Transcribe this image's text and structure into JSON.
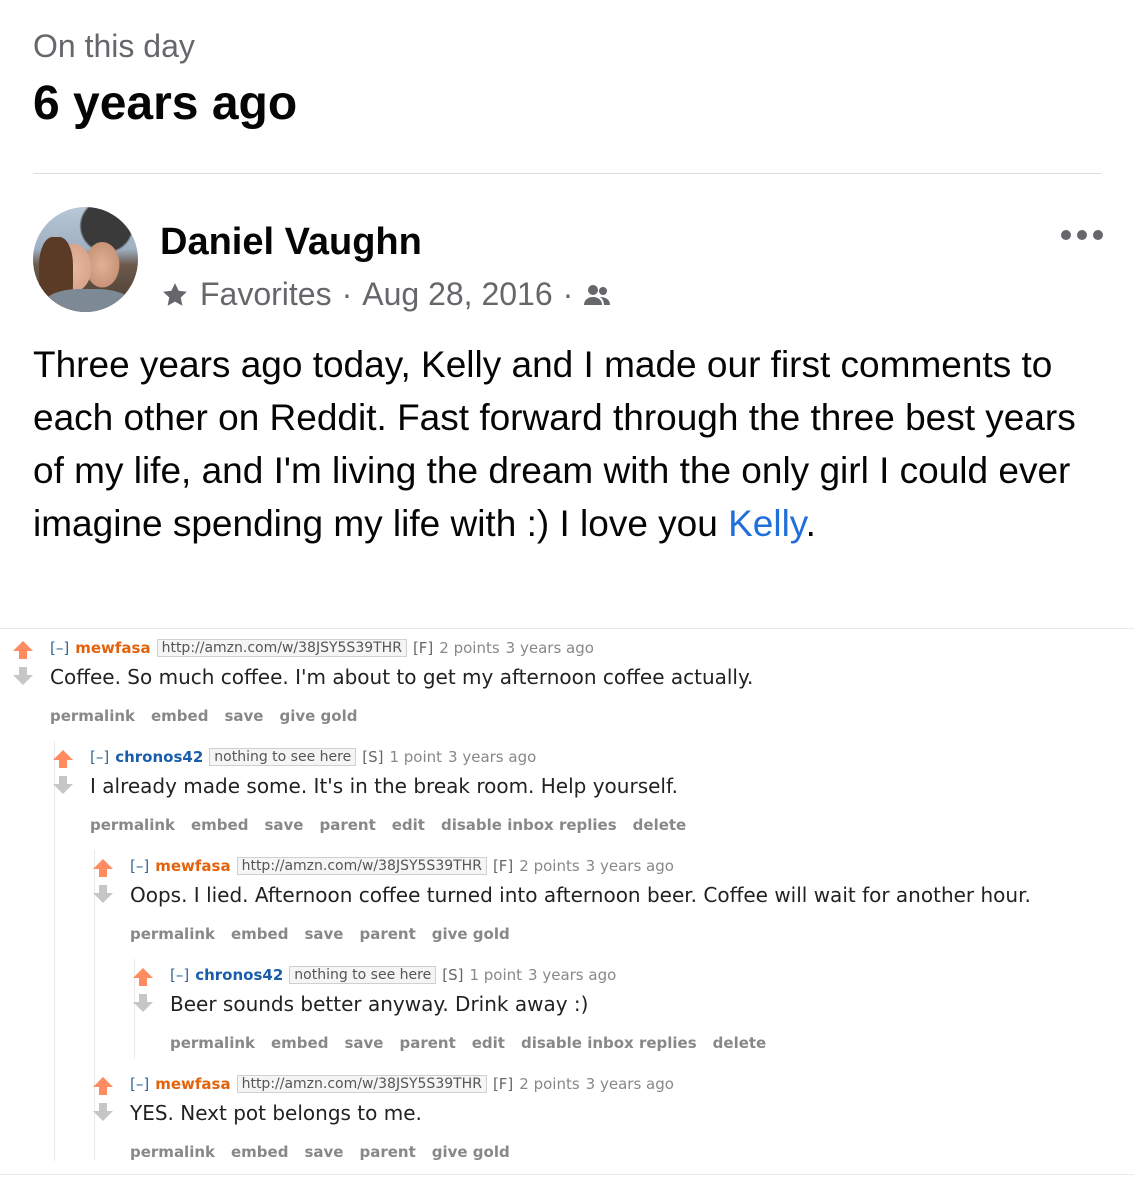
{
  "memory": {
    "label": "On this day",
    "title": "6 years ago"
  },
  "post": {
    "author": "Daniel Vaughn",
    "audience": "Favorites",
    "separator": "·",
    "date": "Aug 28, 2016",
    "text_before_mention": "Three years ago today, Kelly and I made our first comments to each other on Reddit. Fast forward through the three best years of my life, and I'm living the dream with the only girl I could ever imagine spending my life with :) I love you ",
    "mention": "Kelly",
    "text_after_mention": ".",
    "icons": {
      "audience": "star-icon",
      "privacy": "friends-icon",
      "menu": "more-options-icon",
      "avatar": "avatar-photo"
    }
  },
  "comments": [
    {
      "toggle": "[–]",
      "user": "mewfasa",
      "flair": "http://amzn.com/w/38JSY5S39THR",
      "tag": "[F]",
      "score": "2 points",
      "age": "3 years ago",
      "body": "Coffee. So much coffee. I'm about to get my afternoon coffee actually.",
      "actions": [
        "permalink",
        "embed",
        "save",
        "give gold"
      ]
    },
    {
      "toggle": "[–]",
      "user": "chronos42",
      "flair": "nothing to see here",
      "tag": "[S]",
      "score": "1 point",
      "age": "3 years ago",
      "body": "I already made some. It's in the break room. Help yourself.",
      "actions": [
        "permalink",
        "embed",
        "save",
        "parent",
        "edit",
        "disable inbox replies",
        "delete"
      ]
    },
    {
      "toggle": "[–]",
      "user": "mewfasa",
      "flair": "http://amzn.com/w/38JSY5S39THR",
      "tag": "[F]",
      "score": "2 points",
      "age": "3 years ago",
      "body": "Oops. I lied. Afternoon coffee turned into afternoon beer. Coffee will wait for another hour.",
      "actions": [
        "permalink",
        "embed",
        "save",
        "parent",
        "give gold"
      ]
    },
    {
      "toggle": "[–]",
      "user": "chronos42",
      "flair": "nothing to see here",
      "tag": "[S]",
      "score": "1 point",
      "age": "3 years ago",
      "body": "Beer sounds better anyway. Drink away :)",
      "actions": [
        "permalink",
        "embed",
        "save",
        "parent",
        "edit",
        "disable inbox replies",
        "delete"
      ]
    },
    {
      "toggle": "[–]",
      "user": "mewfasa",
      "flair": "http://amzn.com/w/38JSY5S39THR",
      "tag": "[F]",
      "score": "2 points",
      "age": "3 years ago",
      "body": "YES. Next pot belongs to me.",
      "actions": [
        "permalink",
        "embed",
        "save",
        "parent",
        "give gold"
      ]
    }
  ],
  "colors": {
    "mention": "#216fdb",
    "upvote": "#ff8b60",
    "reddit_user": "#1a5eab"
  }
}
